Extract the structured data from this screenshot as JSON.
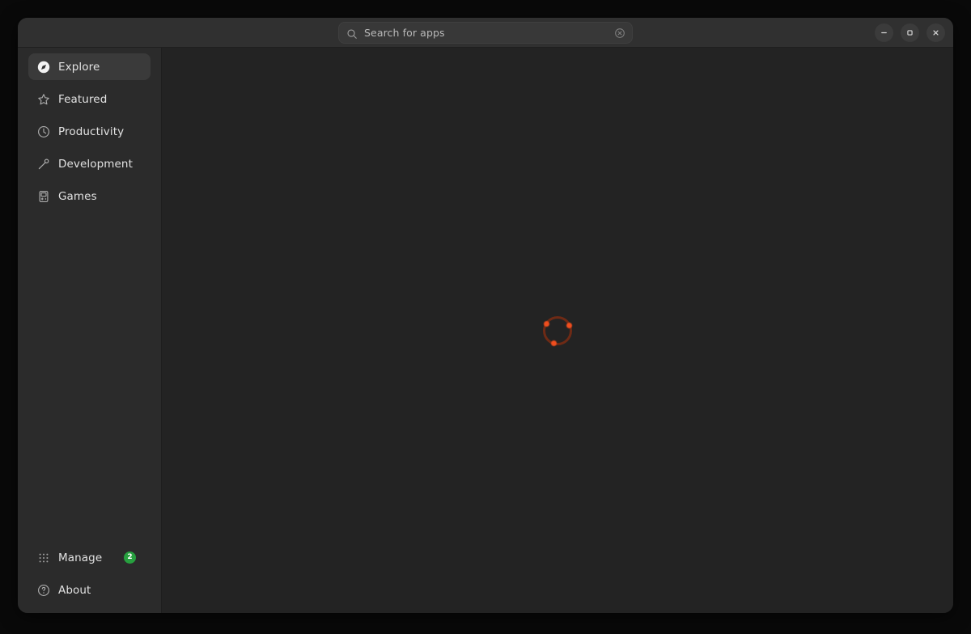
{
  "window": {
    "background_color": "#262626",
    "controls": [
      {
        "name": "minimize",
        "glyph": "minus-icon",
        "label": "Minimize"
      },
      {
        "name": "maximize",
        "glyph": "square-icon",
        "label": "Maximize"
      },
      {
        "name": "close",
        "glyph": "close-icon",
        "label": "Close"
      }
    ]
  },
  "search": {
    "placeholder": "Search for apps",
    "value": "",
    "icon": "search-icon",
    "clear_icon": "clear-circle-icon"
  },
  "sidebar": {
    "background_color": "#2b2b2b",
    "selected_background_color": "#3a3a3a",
    "items": [
      {
        "label": "Explore",
        "icon": "compass-icon",
        "selected": true
      },
      {
        "label": "Featured",
        "icon": "star-icon",
        "selected": false
      },
      {
        "label": "Productivity",
        "icon": "clock-icon",
        "selected": false
      },
      {
        "label": "Development",
        "icon": "screwdriver-icon",
        "selected": false
      },
      {
        "label": "Games",
        "icon": "game-console-icon",
        "selected": false
      }
    ],
    "bottom_items": [
      {
        "label": "Manage",
        "icon": "grid-dots-icon",
        "badge": "2",
        "badge_color": "#27a03f"
      },
      {
        "label": "About",
        "icon": "question-mark-icon",
        "badge": null
      }
    ]
  },
  "content": {
    "background_color": "#232323",
    "state": "loading",
    "spinner": {
      "name": "loading-spinner",
      "color": "#f04e1e",
      "track_color": "#6e2a15"
    }
  }
}
